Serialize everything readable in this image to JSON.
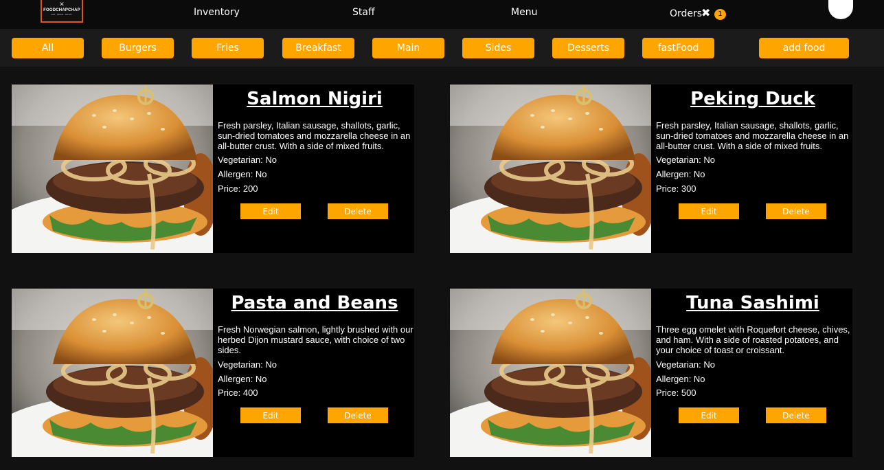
{
  "nav": {
    "logo_text": "FOODCHAPCHAP",
    "logo_sub": "EAT · DRINK · ENJOY",
    "links": [
      {
        "label": "Inventory"
      },
      {
        "label": "Staff"
      },
      {
        "label": "Menu"
      },
      {
        "label": "Orders"
      }
    ],
    "orders_count": "1"
  },
  "categories": [
    {
      "label": "All"
    },
    {
      "label": "Burgers"
    },
    {
      "label": "Fries"
    },
    {
      "label": "Breakfast"
    },
    {
      "label": "Main"
    },
    {
      "label": "Sides"
    },
    {
      "label": "Desserts"
    },
    {
      "label": "fastFood"
    }
  ],
  "add_food_label": "add food",
  "cards": [
    {
      "title": "Salmon Nigiri",
      "description": "Fresh parsley, Italian sausage, shallots, garlic, sun-dried tomatoes and mozzarella cheese in an all-butter crust. With a side of mixed fruits.",
      "vegetarian": "Vegetarian: No",
      "allergen": "Allergen: No",
      "price": "Price: 200",
      "edit": "Edit",
      "delete": "Delete"
    },
    {
      "title": "Peking Duck",
      "description": "Fresh parsley, Italian sausage, shallots, garlic, sun-dried tomatoes and mozzarella cheese in an all-butter crust. With a side of mixed fruits.",
      "vegetarian": "Vegetarian: No",
      "allergen": "Allergen: No",
      "price": "Price: 300",
      "edit": "Edit",
      "delete": "Delete"
    },
    {
      "title": "Pasta and Beans",
      "description": "Fresh Norwegian salmon, lightly brushed with our herbed Dijon mustard sauce, with choice of two sides.",
      "vegetarian": "Vegetarian: No",
      "allergen": "Allergen: No",
      "price": "Price: 400",
      "edit": "Edit",
      "delete": "Delete"
    },
    {
      "title": "Tuna Sashimi",
      "description": "Three egg omelet with Roquefort cheese, chives, and ham. With a side of roasted potatoes, and your choice of toast or croissant.",
      "vegetarian": "Vegetarian: No",
      "allergen": "Allergen: No",
      "price": "Price: 500",
      "edit": "Edit",
      "delete": "Delete"
    }
  ],
  "colors": {
    "accent": "#ffa500",
    "background": "#111111",
    "card": "#000000"
  }
}
